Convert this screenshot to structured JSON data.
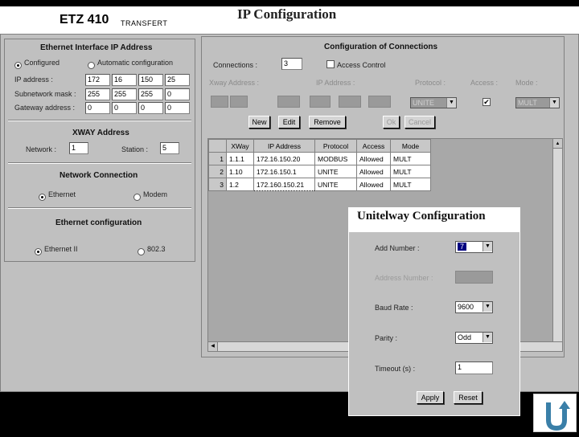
{
  "header": {
    "app_title": "ETZ 410",
    "subtitle": "TRANSFERT",
    "page_title": "IP Configuration"
  },
  "ethernet_interface": {
    "title": "Ethernet Interface IP Address",
    "option_configured": "Configured",
    "option_auto": "Automatic configuration",
    "ip_label": "IP address :",
    "ip": [
      "172",
      "16",
      "150",
      "25"
    ],
    "mask_label": "Subnetwork mask :",
    "mask": [
      "255",
      "255",
      "255",
      "0"
    ],
    "gateway_label": "Gateway address :",
    "gateway": [
      "0",
      "0",
      "0",
      "0"
    ]
  },
  "xway": {
    "title": "XWAY Address",
    "network_label": "Network :",
    "network": "1",
    "station_label": "Station :",
    "station": "5"
  },
  "network_connection": {
    "title": "Network Connection",
    "option_ethernet": "Ethernet",
    "option_modem": "Modem"
  },
  "ethernet_config": {
    "title": "Ethernet configuration",
    "option_ethernet2": "Ethernet II",
    "option_8023": "802.3"
  },
  "connections": {
    "title": "Configuration of Connections",
    "connections_label": "Connections :",
    "connections_value": "3",
    "access_control_label": "Access Control",
    "col_xway": "Xway Address :",
    "col_ip": "IP Address :",
    "col_protocol": "Protocol :",
    "col_access": "Access :",
    "col_mode": "Mode :",
    "protocol_value": "UNITE",
    "mode_value": "MULT",
    "btn_new": "New",
    "btn_edit": "Edit",
    "btn_remove": "Remove",
    "btn_ok": "Ok",
    "btn_cancel": "Cancel",
    "table_headers": [
      "XWay",
      "IP Address",
      "Protocol",
      "Access",
      "Mode"
    ],
    "rows": [
      {
        "num": "1",
        "xway": "1.1.1",
        "ip": "172.16.150.20",
        "protocol": "MODBUS",
        "access": "Allowed",
        "mode": "MULT"
      },
      {
        "num": "2",
        "xway": "1.10",
        "ip": "172.16.150.1",
        "protocol": "UNITE",
        "access": "Allowed",
        "mode": "MULT"
      },
      {
        "num": "3",
        "xway": "1.2",
        "ip": "172.160.150.21",
        "protocol": "UNITE",
        "access": "Allowed",
        "mode": "MULT"
      }
    ]
  },
  "unitelway": {
    "title": "Unitelway Configuration",
    "add_number_label": "Add Number :",
    "add_number_value": "7",
    "address_number_label": "Address Number :",
    "baud_rate_label": "Baud Rate :",
    "baud_rate_value": "9600",
    "parity_label": "Parity :",
    "parity_value": "Odd",
    "timeout_label": "Timeout (s) :",
    "timeout_value": "1",
    "btn_apply": "Apply",
    "btn_reset": "Reset"
  },
  "icons": {
    "return": "u-turn-return-icon"
  },
  "colors": {
    "panel": "#c0c0c0",
    "background": "#000000",
    "return_icon": "#3a7fa8"
  }
}
